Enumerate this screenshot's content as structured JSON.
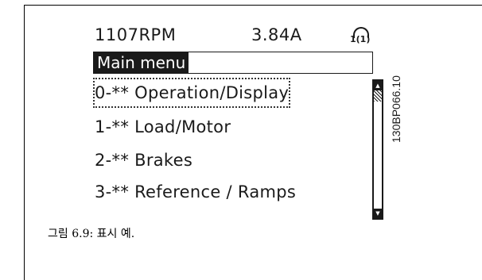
{
  "lcd": {
    "status": {
      "speed": "1107RPM",
      "current": "3.84A",
      "setup_icon_text": "1(1)"
    },
    "title": "Main menu",
    "menu_items": [
      {
        "label": "0-** Operation/Display",
        "selected": true
      },
      {
        "label": "1-** Load/Motor",
        "selected": false
      },
      {
        "label": "2-** Brakes",
        "selected": false
      },
      {
        "label": "3-** Reference / Ramps",
        "selected": false
      }
    ],
    "scrollbar": {
      "up_icon": "arrow-up-icon",
      "down_icon": "arrow-down-icon"
    }
  },
  "figure_code": "130BP066.10",
  "caption": "그림 6.9: 표시 예."
}
